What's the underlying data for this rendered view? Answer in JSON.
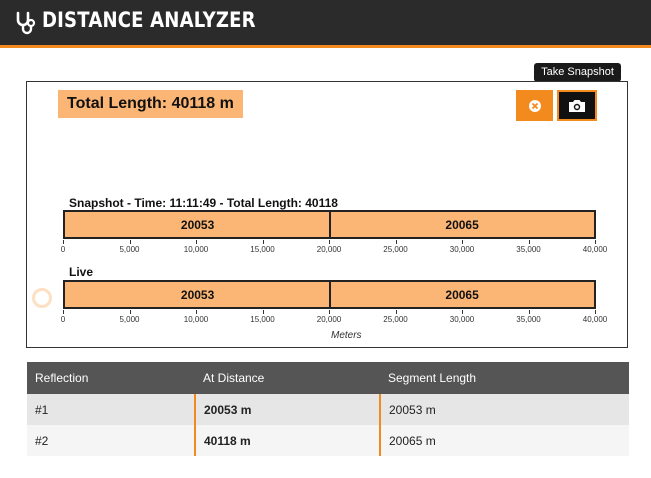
{
  "app": {
    "title": "DISTANCE ANALYZER",
    "logo_icon": "stethoscope-icon"
  },
  "total": {
    "label": "Total Length: 40118 m"
  },
  "toolbar": {
    "clear_icon": "clear-icon",
    "snapshot_icon": "camera-icon",
    "tooltip": "Take Snapshot"
  },
  "colors": {
    "accent": "#f28a1e",
    "bar_fill": "#fbb574",
    "header_bg": "#2b2b2b",
    "table_header_bg": "#555555"
  },
  "chart_data": [
    {
      "type": "bar",
      "title": "Snapshot - Time: 11:11:49 - Total Length: 40118",
      "orientation": "horizontal-stacked",
      "segments": [
        {
          "value": 20053,
          "label": "20053"
        },
        {
          "value": 20065,
          "label": "20065"
        }
      ],
      "xlim": [
        0,
        40000
      ],
      "ticks": [
        "0",
        "5,000",
        "10,000",
        "15,000",
        "20,000",
        "25,000",
        "30,000",
        "35,000",
        "40,000"
      ]
    },
    {
      "type": "bar",
      "title": "Live",
      "orientation": "horizontal-stacked",
      "segments": [
        {
          "value": 20053,
          "label": "20053"
        },
        {
          "value": 20065,
          "label": "20065"
        }
      ],
      "xlim": [
        0,
        40000
      ],
      "ticks": [
        "0",
        "5,000",
        "10,000",
        "15,000",
        "20,000",
        "25,000",
        "30,000",
        "35,000",
        "40,000"
      ],
      "xlabel": "Meters"
    }
  ],
  "table": {
    "columns": [
      "Reflection",
      "At Distance",
      "Segment Length"
    ],
    "rows": [
      [
        "#1",
        "20053 m",
        "20053 m"
      ],
      [
        "#2",
        "40118 m",
        "20065 m"
      ]
    ]
  }
}
